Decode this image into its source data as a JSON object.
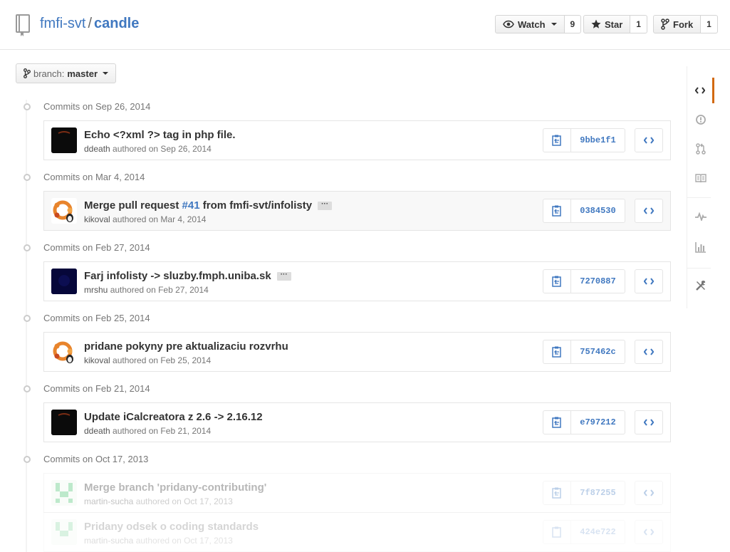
{
  "repo": {
    "owner": "fmfi-svt",
    "separator": "/",
    "name": "candle"
  },
  "actions": {
    "watch": {
      "label": "Watch",
      "count": "9"
    },
    "star": {
      "label": "Star",
      "count": "1"
    },
    "fork": {
      "label": "Fork",
      "count": "1"
    }
  },
  "branch": {
    "label": "branch:",
    "value": "master"
  },
  "groups": [
    {
      "date_prefix": "Commits on ",
      "date": "Sep 26, 2014",
      "commits": [
        {
          "title": "Echo <?xml ?> tag in php file.",
          "author": "ddeath",
          "authored": "authored on Sep 26, 2014",
          "sha": "9bbe1f1"
        }
      ]
    },
    {
      "date_prefix": "Commits on ",
      "date": "Mar 4, 2014",
      "commits": [
        {
          "title_pre": "Merge pull request ",
          "pr": "#41",
          "title_post": " from fmfi-svt/infolisty",
          "ellipsis": "···",
          "author": "kikoval",
          "authored": "authored on Mar 4, 2014",
          "sha": "0384530"
        }
      ]
    },
    {
      "date_prefix": "Commits on ",
      "date": "Feb 27, 2014",
      "commits": [
        {
          "title": "Farj infolisty -> sluzby.fmph.uniba.sk",
          "ellipsis": "···",
          "author": "mrshu",
          "authored": "authored on Feb 27, 2014",
          "sha": "7270887"
        }
      ]
    },
    {
      "date_prefix": "Commits on ",
      "date": "Feb 25, 2014",
      "commits": [
        {
          "title": "pridane pokyny pre aktualizaciu rozvrhu",
          "author": "kikoval",
          "authored": "authored on Feb 25, 2014",
          "sha": "757462c"
        }
      ]
    },
    {
      "date_prefix": "Commits on ",
      "date": "Feb 21, 2014",
      "commits": [
        {
          "title": "Update iCalcreatora z 2.6 -> 2.16.12",
          "author": "ddeath",
          "authored": "authored on Feb 21, 2014",
          "sha": "e797212"
        }
      ]
    },
    {
      "date_prefix": "Commits on ",
      "date": "Oct 17, 2013",
      "commits": [
        {
          "title": "Merge branch 'pridany-contributing'",
          "author": "martin-sucha",
          "authored": "authored on Oct 17, 2013",
          "sha": "7f87255"
        },
        {
          "title": "Pridany odsek o coding standards",
          "author": "martin-sucha",
          "authored": "authored on Oct 17, 2013",
          "sha": "424e722"
        }
      ]
    }
  ],
  "right_nav": [
    "code-icon",
    "issues-icon",
    "pull-requests-icon",
    "wiki-icon",
    "pulse-icon",
    "graphs-icon",
    "settings-icon"
  ],
  "colors": {
    "link": "#4078c0",
    "selected_tab": "#d26911"
  }
}
